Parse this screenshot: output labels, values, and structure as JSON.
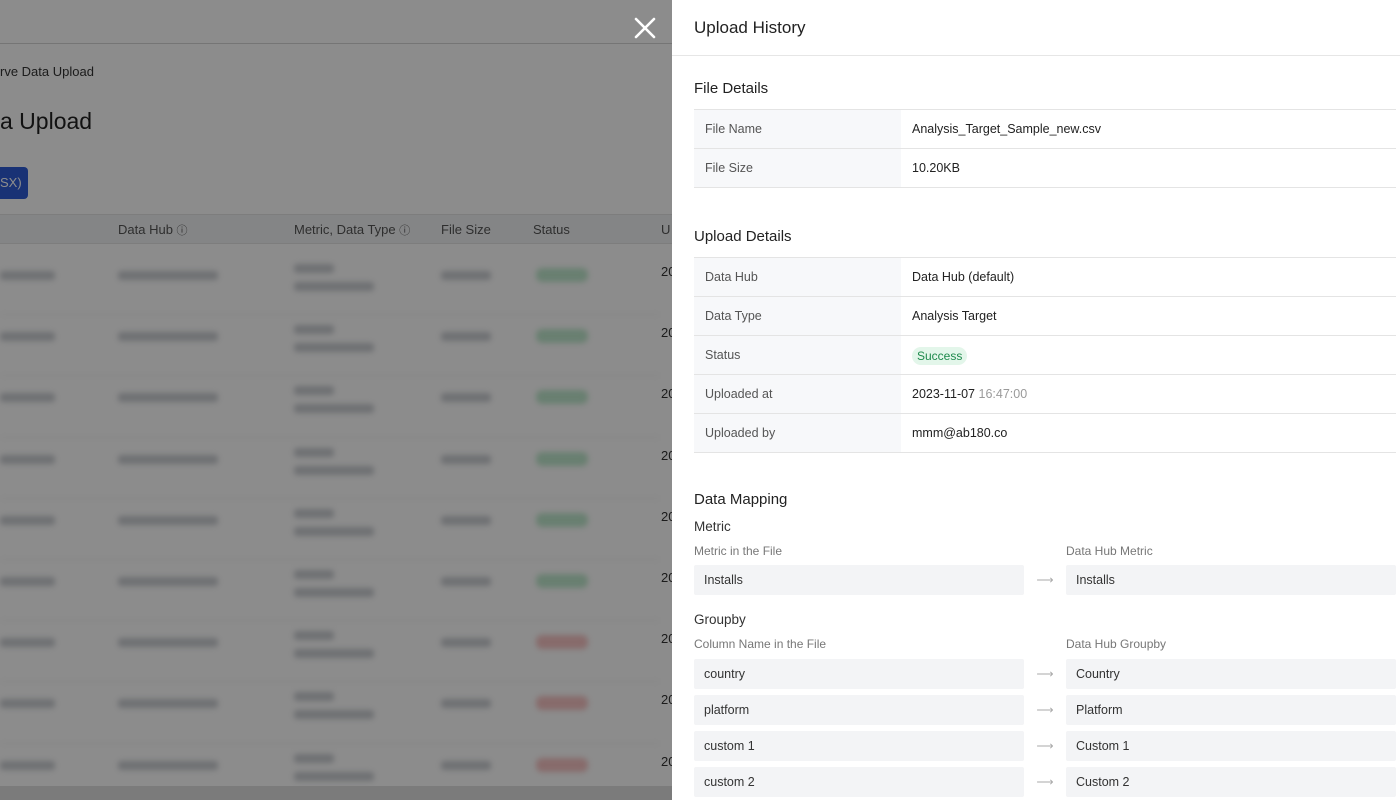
{
  "background": {
    "breadcrumb": "rve Data Upload",
    "page_title": "a Upload",
    "upload_button": "SX)",
    "table_headers": [
      "Data Hub",
      "Metric, Data Type",
      "File Size",
      "Status",
      "U"
    ],
    "u_col_prefix": [
      "20",
      "20",
      "20",
      "20",
      "20",
      "20",
      "20",
      "20",
      "20"
    ],
    "row_statuses": [
      "success",
      "success",
      "success",
      "success",
      "success",
      "success",
      "failed",
      "failed",
      "failed"
    ]
  },
  "drawer": {
    "title": "Upload History",
    "file_details": {
      "title": "File Details",
      "rows": [
        {
          "label": "File Name",
          "value": "Analysis_Target_Sample_new.csv"
        },
        {
          "label": "File Size",
          "value": "10.20KB"
        }
      ]
    },
    "upload_details": {
      "title": "Upload Details",
      "data_hub": {
        "label": "Data Hub",
        "value": "Data Hub (default)"
      },
      "data_type": {
        "label": "Data Type",
        "value": "Analysis Target"
      },
      "status": {
        "label": "Status",
        "value": "Success"
      },
      "uploaded_at": {
        "label": "Uploaded at",
        "date": "2023-11-07",
        "time": "16:47:00"
      },
      "uploaded_by": {
        "label": "Uploaded by",
        "value": "mmm@ab180.co"
      }
    },
    "data_mapping": {
      "title": "Data Mapping",
      "metric": {
        "title": "Metric",
        "col_left": "Metric in the File",
        "col_right": "Data Hub Metric",
        "rows": [
          {
            "from": "Installs",
            "to": "Installs"
          }
        ]
      },
      "groupby": {
        "title": "Groupby",
        "col_left": "Column Name in the File",
        "col_right": "Data Hub Groupby",
        "rows": [
          {
            "from": "country",
            "to": "Country"
          },
          {
            "from": "platform",
            "to": "Platform"
          },
          {
            "from": "custom 1",
            "to": "Custom 1"
          },
          {
            "from": "custom 2",
            "to": "Custom 2"
          }
        ]
      }
    }
  },
  "colors": {
    "success_text": "#1e8a4c",
    "success_bg": "#e3f6ea",
    "failed": "#e57373",
    "primary": "#2f5cd6"
  }
}
